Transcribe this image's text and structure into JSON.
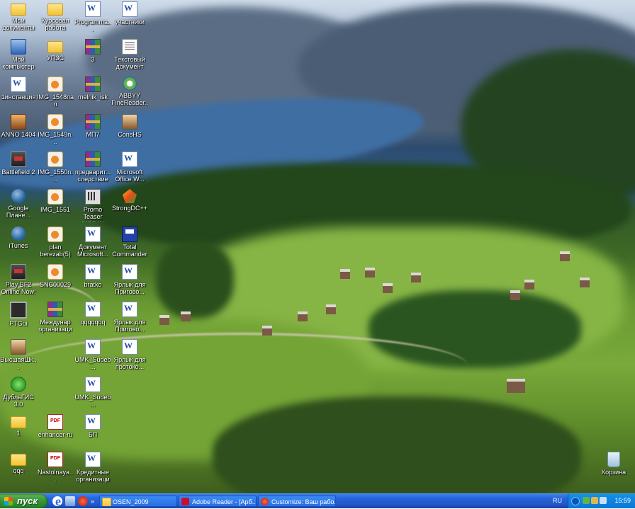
{
  "desktop": {
    "icons": [
      {
        "label": "Мои документы",
        "type": "folder-docs-icon"
      },
      {
        "label": "Курсовая работа",
        "type": "folder-icon"
      },
      {
        "label": "Programma...",
        "type": "word-icon"
      },
      {
        "label": "участники",
        "type": "word-icon"
      },
      {
        "label": "Мой компьютер",
        "type": "computer-icon"
      },
      {
        "label": "УПЗС",
        "type": "folder-icon"
      },
      {
        "label": "3",
        "type": "rar-icon"
      },
      {
        "label": "Текстовый документ",
        "type": "text-document-icon"
      },
      {
        "label": "1инстанция",
        "type": "word-icon"
      },
      {
        "label": "IMG_1548пап",
        "type": "image-icon"
      },
      {
        "label": "melnik_isk",
        "type": "rar-icon"
      },
      {
        "label": "ABBYY FineReader...",
        "type": "abbyy-icon"
      },
      {
        "label": "ANNO 1404",
        "type": "game-icon"
      },
      {
        "label": "IMG_1549n...",
        "type": "image-icon"
      },
      {
        "label": "МП7",
        "type": "rar-icon"
      },
      {
        "label": "ConsHS",
        "type": "person-icon"
      },
      {
        "label": "Battlefield 2",
        "type": "game-icon"
      },
      {
        "label": "IMG_1550n...",
        "type": "image-icon"
      },
      {
        "label": "предварит... следствие",
        "type": "rar-icon"
      },
      {
        "label": "Microsoft Office W...",
        "type": "word-icon"
      },
      {
        "label": "Google Плане...",
        "type": "globe-icon"
      },
      {
        "label": "IMG_1551",
        "type": "image-icon"
      },
      {
        "label": "Promo Teaser (WMVA)",
        "type": "video-icon"
      },
      {
        "label": "StrongDC++",
        "type": "strongdc-icon"
      },
      {
        "label": "iTunes",
        "type": "itunes-icon"
      },
      {
        "label": "plan berezab(5)",
        "type": "image-icon"
      },
      {
        "label": "Документ Microsoft...",
        "type": "word-icon"
      },
      {
        "label": "Total Commander",
        "type": "total-commander-icon"
      },
      {
        "label": "Play BF2 Online Now!",
        "type": "game-icon"
      },
      {
        "label": "SNC00029",
        "type": "image-icon"
      },
      {
        "label": "bratko",
        "type": "word-icon"
      },
      {
        "label": "Ярлык для Пригово...",
        "type": "word-icon"
      },
      {
        "label": "PTGui",
        "type": "terminal-icon"
      },
      {
        "label": "Междунар организации",
        "type": "rar-icon"
      },
      {
        "label": "qqqqqqq",
        "type": "word-icon"
      },
      {
        "label": "Ярлык для Пригово...",
        "type": "word-icon"
      },
      {
        "label": "ВысшаяШк...",
        "type": "person-icon"
      },
      {
        "label": "UMK_Sudeb...",
        "type": "word-icon"
      },
      {
        "label": "Ярлык для протоко...",
        "type": "word-icon"
      },
      {
        "label": "ДубльГИС 3.0",
        "type": "green-app-icon"
      },
      {
        "label": "UMK_Sudeb...",
        "type": "word-icon"
      },
      {
        "label": "1",
        "type": "folder-icon"
      },
      {
        "label": "enhancer-ru",
        "type": "pdf-icon"
      },
      {
        "label": "БП",
        "type": "word-icon"
      },
      {
        "label": "qqq",
        "type": "folder-icon"
      },
      {
        "label": "Nastolnaya...",
        "type": "pdf-icon"
      },
      {
        "label": "Кредитные организации",
        "type": "word-icon"
      },
      {
        "label": "Корзина",
        "type": "recycle-bin-icon"
      }
    ]
  },
  "taskbar": {
    "start_label": "пуск",
    "tasks": [
      {
        "label": "OSEN_2009",
        "icon": "folder-icon"
      },
      {
        "label": "Adobe Reader - [Арб...",
        "icon": "adobe-reader-icon"
      },
      {
        "label": "Customize: Ваш рабо...",
        "icon": "opera-icon"
      }
    ],
    "language": "RU",
    "clock": "15:59"
  }
}
